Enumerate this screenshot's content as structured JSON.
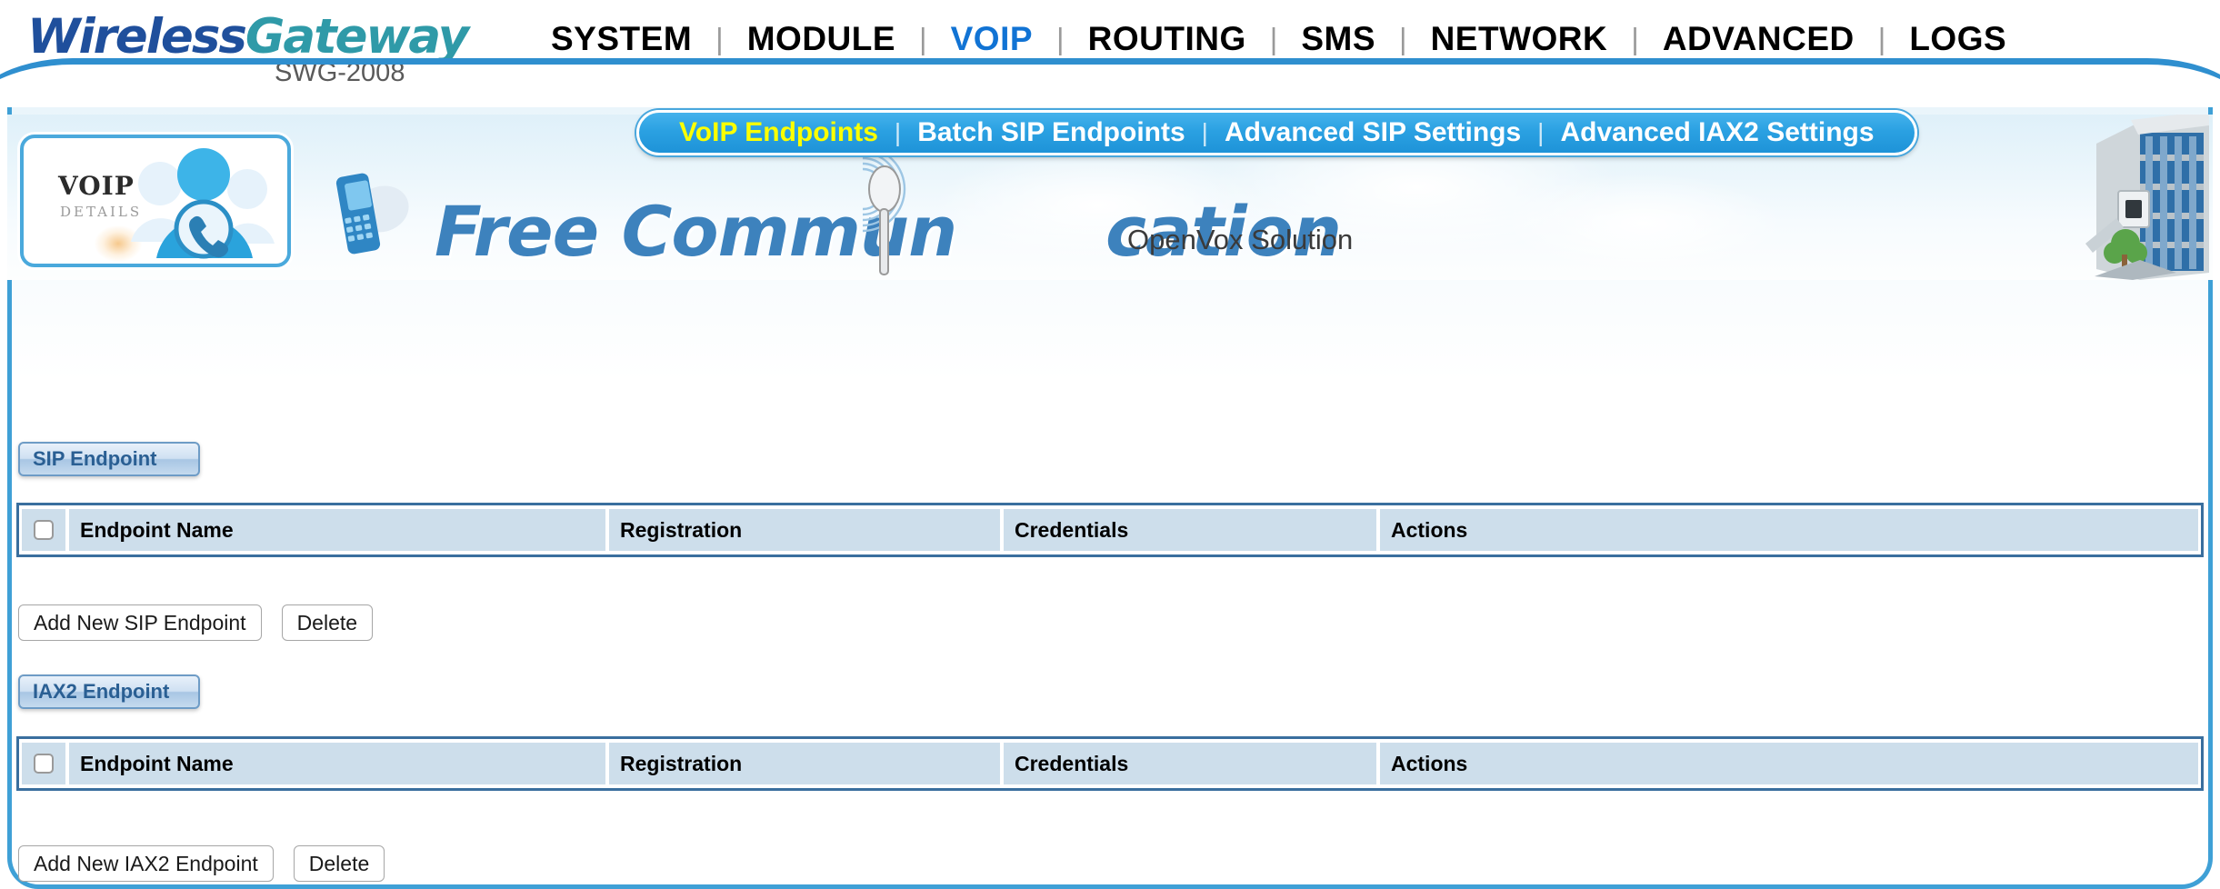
{
  "brand": {
    "name_part1": "Wireless",
    "name_part2": "Gateway",
    "model": "SWG-2008",
    "accent_blue": "#1f4f9c",
    "accent_teal": "#2f9aa8"
  },
  "mainnav": {
    "items": [
      {
        "label": "SYSTEM",
        "active": false
      },
      {
        "label": "MODULE",
        "active": false
      },
      {
        "label": "VOIP",
        "active": true
      },
      {
        "label": "ROUTING",
        "active": false
      },
      {
        "label": "SMS",
        "active": false
      },
      {
        "label": "NETWORK",
        "active": false
      },
      {
        "label": "ADVANCED",
        "active": false
      },
      {
        "label": "LOGS",
        "active": false
      }
    ],
    "separator": "|",
    "active_color": "#1173d4"
  },
  "subnav": {
    "items": [
      {
        "label": "VoIP Endpoints",
        "active": true
      },
      {
        "label": "Batch SIP Endpoints",
        "active": false
      },
      {
        "label": "Advanced SIP Settings",
        "active": false
      },
      {
        "label": "Advanced IAX2 Settings",
        "active": false
      }
    ],
    "separator": "|",
    "active_color": "#fbff00",
    "pill_color": "#2ba1e2"
  },
  "banner": {
    "card_title": "VOIP",
    "card_subtitle": "DETAILS",
    "headline": "Free Communication",
    "headline_left": "Free Commun",
    "headline_right": "cation",
    "vendor": "OpenVox Solution",
    "headline_color": "#3d82bd"
  },
  "sip_section": {
    "title": "SIP Endpoint",
    "columns": [
      "",
      "Endpoint Name",
      "Registration",
      "Credentials",
      "Actions"
    ],
    "rows": [],
    "add_button": "Add New SIP Endpoint",
    "delete_button": "Delete"
  },
  "iax2_section": {
    "title": "IAX2 Endpoint",
    "columns": [
      "",
      "Endpoint Name",
      "Registration",
      "Credentials",
      "Actions"
    ],
    "rows": [],
    "add_button": "Add New IAX2 Endpoint",
    "delete_button": "Delete"
  }
}
